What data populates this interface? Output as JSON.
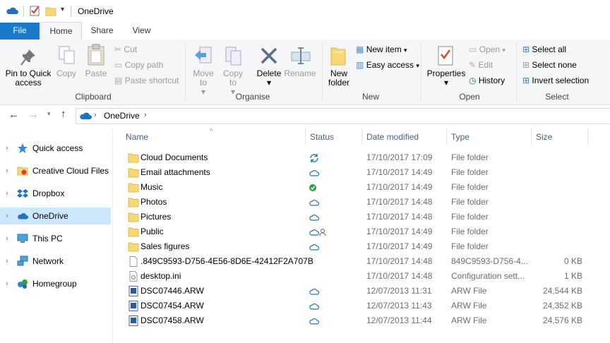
{
  "window": {
    "title": "OneDrive"
  },
  "tabs": [
    {
      "label": "File"
    },
    {
      "label": "Home"
    },
    {
      "label": "Share"
    },
    {
      "label": "View"
    }
  ],
  "ribbon": {
    "clipboard": {
      "group": "Clipboard",
      "pin": "Pin to Quick access",
      "copy": "Copy",
      "paste": "Paste",
      "cut": "Cut",
      "copy_path": "Copy path",
      "paste_shortcut": "Paste shortcut"
    },
    "organise": {
      "group": "Organise",
      "move_to": "Move to",
      "copy_to": "Copy to",
      "delete": "Delete",
      "rename": "Rename"
    },
    "new": {
      "group": "New",
      "new_folder": "New folder",
      "new_item": "New item",
      "easy_access": "Easy access"
    },
    "open": {
      "group": "Open",
      "properties": "Properties",
      "open": "Open",
      "edit": "Edit",
      "history": "History"
    },
    "select": {
      "group": "Select",
      "select_all": "Select all",
      "select_none": "Select none",
      "invert": "Invert selection"
    }
  },
  "address": {
    "crumb": "OneDrive"
  },
  "nav": [
    {
      "label": "Quick access",
      "icon": "star-icon"
    },
    {
      "label": "Creative Cloud Files",
      "icon": "creative-cloud-icon"
    },
    {
      "label": "Dropbox",
      "icon": "dropbox-icon"
    },
    {
      "label": "OneDrive",
      "icon": "onedrive-icon",
      "selected": true
    },
    {
      "label": "This PC",
      "icon": "computer-icon"
    },
    {
      "label": "Network",
      "icon": "network-icon"
    },
    {
      "label": "Homegroup",
      "icon": "homegroup-icon"
    }
  ],
  "columns": {
    "name": "Name",
    "status": "Status",
    "date": "Date modified",
    "type": "Type",
    "size": "Size"
  },
  "files": [
    {
      "name": "Cloud Documents",
      "status": "syncing",
      "date": "17/10/2017 17:09",
      "type": "File folder",
      "size": "",
      "kind": "folder"
    },
    {
      "name": "Email attachments",
      "status": "cloud",
      "date": "17/10/2017 14:49",
      "type": "File folder",
      "size": "",
      "kind": "folder"
    },
    {
      "name": "Music",
      "status": "available",
      "date": "17/10/2017 14:49",
      "type": "File folder",
      "size": "",
      "kind": "folder"
    },
    {
      "name": "Photos",
      "status": "cloud",
      "date": "17/10/2017 14:48",
      "type": "File folder",
      "size": "",
      "kind": "folder"
    },
    {
      "name": "Pictures",
      "status": "cloud",
      "date": "17/10/2017 14:48",
      "type": "File folder",
      "size": "",
      "kind": "folder"
    },
    {
      "name": "Public",
      "status": "shared",
      "date": "17/10/2017 14:49",
      "type": "File folder",
      "size": "",
      "kind": "folder"
    },
    {
      "name": "Sales figures",
      "status": "cloud",
      "date": "17/10/2017 14:49",
      "type": "File folder",
      "size": "",
      "kind": "folder"
    },
    {
      "name": ".849C9593-D756-4E56-8D6E-42412F2A707B",
      "status": "",
      "date": "17/10/2017 14:48",
      "type": "849C9593-D756-4...",
      "size": "0 KB",
      "kind": "file"
    },
    {
      "name": "desktop.ini",
      "status": "",
      "date": "17/10/2017 14:48",
      "type": "Configuration sett...",
      "size": "1 KB",
      "kind": "ini"
    },
    {
      "name": "DSC07446.ARW",
      "status": "cloud",
      "date": "12/07/2013 11:31",
      "type": "ARW File",
      "size": "24,544 KB",
      "kind": "image"
    },
    {
      "name": "DSC07454.ARW",
      "status": "cloud",
      "date": "12/07/2013 11:43",
      "type": "ARW File",
      "size": "24,352 KB",
      "kind": "image"
    },
    {
      "name": "DSC07458.ARW",
      "status": "cloud",
      "date": "12/07/2013 11:44",
      "type": "ARW File",
      "size": "24,576 KB",
      "kind": "image"
    }
  ],
  "colors": {
    "accent": "#1979ca",
    "folder": "#f8d775",
    "selection": "#cce8ff",
    "cloud": "#1e73be",
    "ok": "#29a33b"
  }
}
